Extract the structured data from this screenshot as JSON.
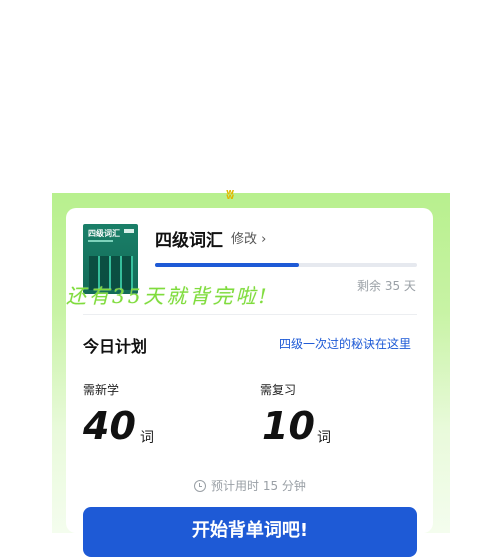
{
  "book": {
    "cover_title": "四级词汇",
    "title": "四级词汇",
    "edit_label": "修改 ›",
    "progress_fraction": 0.55,
    "remaining_label": "剩余 35 天"
  },
  "handwritten_note": "还有35天就背完啦!",
  "plan": {
    "title": "今日计划",
    "secret_link": "四级一次过的秘诀在这里",
    "new_label": "需新学",
    "new_count": "40",
    "new_unit": "词",
    "review_label": "需复习",
    "review_count": "10",
    "review_unit": "词",
    "time_estimate": "预计用时 15 分钟"
  },
  "start_button_label": "开始背单词吧!",
  "colors": {
    "accent": "#1e5ad6",
    "panel_green": "#b8f08e",
    "handwriting_green": "#7fdc3d",
    "cover_green": "#1a7f68"
  },
  "icons": {
    "time": "clock-icon",
    "edit": "chevron-right-icon"
  }
}
